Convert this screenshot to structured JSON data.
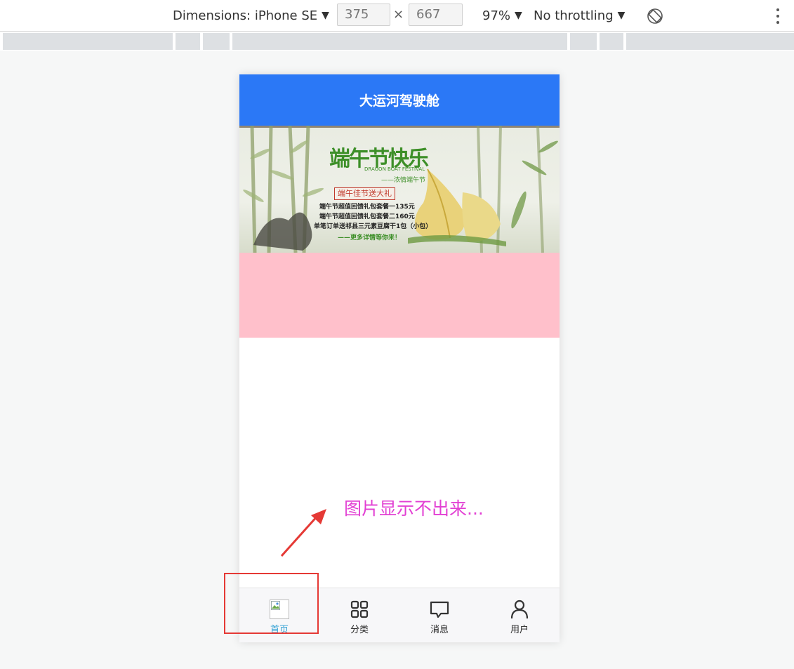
{
  "devtools": {
    "dimensions_label": "Dimensions: iPhone SE",
    "width_value": "375",
    "height_value": "667",
    "times_sign": "×",
    "zoom": "97%",
    "throttling": "No throttling",
    "caret": "▼"
  },
  "app": {
    "header_title": "大运河驾驶舱"
  },
  "banner": {
    "title": "端午节快乐",
    "english": "DRAGON BOAT FESTIVAL",
    "subtitle": "——浓情端午节",
    "highlight": "端午佳节送大礼",
    "lines": [
      "端午节超值回馈礼包套餐一135元",
      "端午节超值回馈礼包套餐二160元",
      "单笔订单送祁县三元素豆腐干1包（小包）"
    ],
    "more": "——更多详情等你来！"
  },
  "tabbar": {
    "items": [
      {
        "label": "首页",
        "icon": "broken-image-icon",
        "active": true
      },
      {
        "label": "分类",
        "icon": "grid-icon",
        "active": false
      },
      {
        "label": "消息",
        "icon": "message-icon",
        "active": false
      },
      {
        "label": "用户",
        "icon": "user-icon",
        "active": false
      }
    ]
  },
  "annotation": {
    "text": "图片显示不出来...",
    "color": "#e23fd3",
    "box_color": "#e53935"
  },
  "colors": {
    "header_bg": "#2b78f6",
    "pink_block": "#ffc0cb",
    "active_tab": "#2fa0d4"
  }
}
